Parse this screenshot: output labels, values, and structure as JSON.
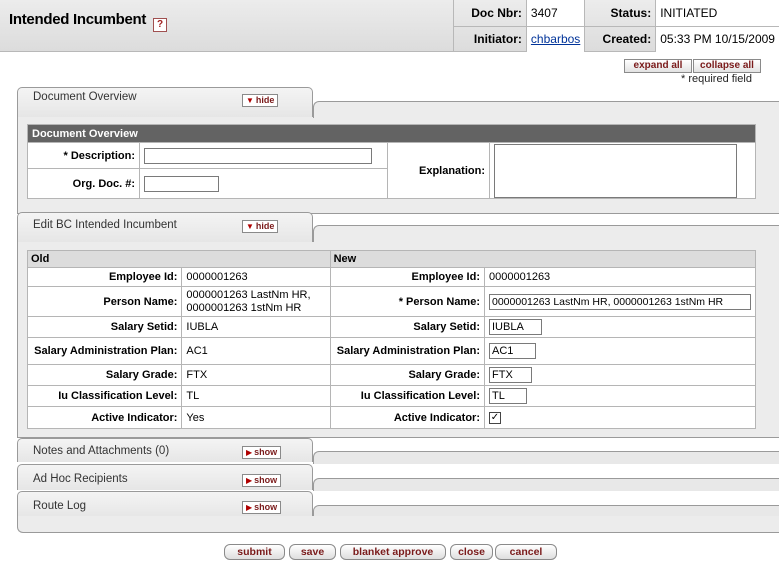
{
  "header": {
    "title": "Intended Incumbent",
    "help_symbol": "?",
    "doc_nbr_label": "Doc Nbr:",
    "doc_nbr": "3407",
    "status_label": "Status:",
    "status": "INITIATED",
    "initiator_label": "Initiator:",
    "initiator": "chbarbos",
    "created_label": "Created:",
    "created": "05:33 PM 10/15/2009"
  },
  "controls": {
    "expand_all": "expand all",
    "collapse_all": "collapse all",
    "required_note": "* required field"
  },
  "tabs": {
    "document_overview": {
      "label": "Document Overview",
      "toggle": "hide"
    },
    "edit_bc": {
      "label": "Edit BC Intended Incumbent",
      "toggle": "hide"
    },
    "notes": {
      "label": "Notes and Attachments (0)",
      "toggle": "show"
    },
    "adhoc": {
      "label": "Ad Hoc Recipients",
      "toggle": "show"
    },
    "routelog": {
      "label": "Route Log",
      "toggle": "show"
    }
  },
  "overview": {
    "section_title": "Document Overview",
    "description_label": "* Description:",
    "description_value": "",
    "org_doc_label": "Org. Doc. #:",
    "org_doc_value": "",
    "explanation_label": "Explanation:",
    "explanation_value": ""
  },
  "edit": {
    "old_header": "Old",
    "new_header": "New",
    "rows": [
      {
        "label": "Employee Id:",
        "old": "0000001263",
        "new": "0000001263"
      },
      {
        "label": "Person Name:",
        "new_label": "*  Person Name:",
        "old": "0000001263 LastNm HR, 0000001263 1stNm HR",
        "new": "0000001263 LastNm HR, 0000001263 1stNm HR"
      },
      {
        "label": "Salary Setid:",
        "old": "IUBLA",
        "new": "IUBLA"
      },
      {
        "label": "Salary Administration Plan:",
        "old": "AC1",
        "new": "AC1"
      },
      {
        "label": "Salary Grade:",
        "old": "FTX",
        "new": "FTX"
      },
      {
        "label": "Iu Classification Level:",
        "old": "TL",
        "new": "TL"
      },
      {
        "label": "Active Indicator:",
        "old": "Yes",
        "new": "checked",
        "new_checkbox_glyph": "✓"
      }
    ]
  },
  "actions": {
    "submit": "submit",
    "save": "save",
    "blanket_approve": "blanket approve",
    "close": "close",
    "cancel": "cancel"
  },
  "colors": {
    "section_header_bg": "#636363",
    "button_text": "#7a1a1a",
    "link": "#003399"
  }
}
